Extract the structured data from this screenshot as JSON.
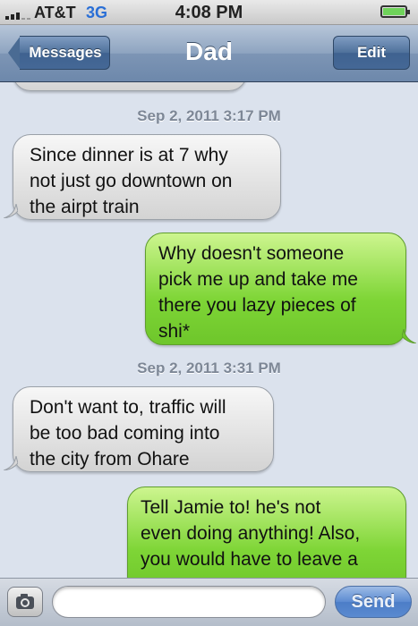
{
  "status_bar": {
    "carrier": "AT&T",
    "network": "3G",
    "time": "4:08 PM",
    "battery_level": 1.0
  },
  "nav": {
    "back_label": "Messages",
    "title": "Dad",
    "edit_label": "Edit"
  },
  "conversation": {
    "timestamps": [
      "Sep 2, 2011 3:17 PM",
      "Sep 2, 2011 3:31 PM"
    ],
    "messages": [
      {
        "direction": "incoming",
        "lines": [
          "Since dinner is at 7 why",
          "not just go downtown on",
          "the airpt train"
        ]
      },
      {
        "direction": "outgoing",
        "lines": [
          "Why doesn't someone",
          "pick me up and take me",
          "there you lazy pieces of",
          "shi*"
        ]
      },
      {
        "direction": "incoming",
        "lines": [
          "Don't want to, traffic will",
          "be too bad coming into",
          "the city from Ohare"
        ]
      },
      {
        "direction": "outgoing",
        "lines": [
          "Tell Jamie to! he's not",
          "even doing anything! Also,",
          "you would have to leave a"
        ]
      }
    ]
  },
  "input_bar": {
    "text_value": "",
    "send_label": "Send"
  },
  "colors": {
    "incoming_bubble": "#e6e6e6",
    "outgoing_bubble": "#8bdc45",
    "background": "#dbe2ed",
    "nav": "#7d95b5"
  }
}
